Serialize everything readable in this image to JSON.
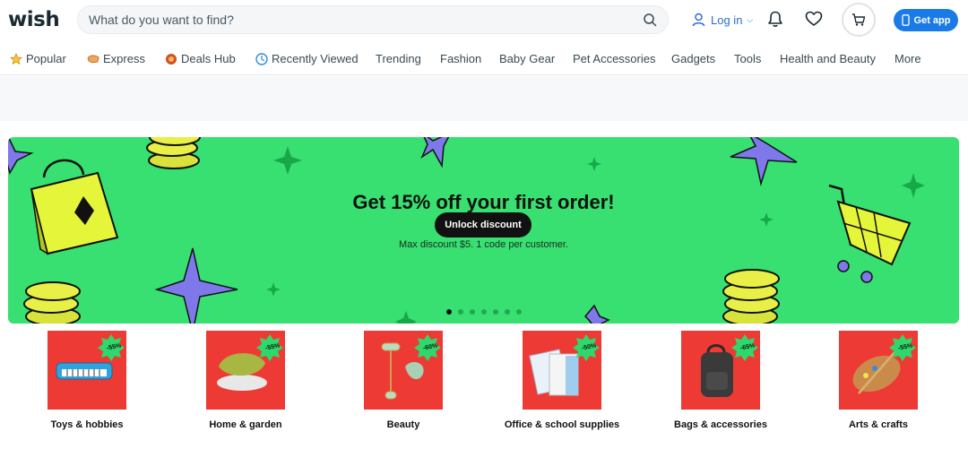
{
  "header": {
    "logo": "wish",
    "search_placeholder": "What do you want to find?",
    "login_label": "Log in",
    "get_app_label": "Get app"
  },
  "nav": {
    "items": [
      {
        "label": "Popular",
        "icon": "star-icon"
      },
      {
        "label": "Express",
        "icon": "express-icon"
      },
      {
        "label": "Deals Hub",
        "icon": "deals-icon"
      },
      {
        "label": "Recently Viewed",
        "icon": "clock-icon"
      },
      {
        "label": "Trending"
      },
      {
        "label": "Fashion"
      },
      {
        "label": "Baby Gear"
      },
      {
        "label": "Pet Accessories"
      },
      {
        "label": "Gadgets"
      },
      {
        "label": "Tools"
      },
      {
        "label": "Health and Beauty"
      },
      {
        "label": "More"
      }
    ]
  },
  "banner": {
    "title": "Get 15% off your first order!",
    "button_label": "Unlock discount",
    "subtitle": "Max discount $5. 1 code per customer.",
    "slide_count": 7,
    "active_slide": 1
  },
  "categories": [
    {
      "label": "Toys & hobbies",
      "badge": "-55%",
      "icon": "keyboard-toy-icon"
    },
    {
      "label": "Home & garden",
      "badge": "-55%",
      "icon": "pillow-icon"
    },
    {
      "label": "Beauty",
      "badge": "-60%",
      "icon": "face-roller-icon"
    },
    {
      "label": "Office & school supplies",
      "badge": "-50%",
      "icon": "notebooks-icon"
    },
    {
      "label": "Bags & accessories",
      "badge": "-65%",
      "icon": "backpack-icon"
    },
    {
      "label": "Arts & crafts",
      "badge": "-55%",
      "icon": "palette-icon"
    }
  ],
  "colors": {
    "brand_blue": "#1a7be8",
    "banner_green": "#37e070",
    "category_red": "#ee3a35",
    "badge_green": "#2fd86a"
  }
}
